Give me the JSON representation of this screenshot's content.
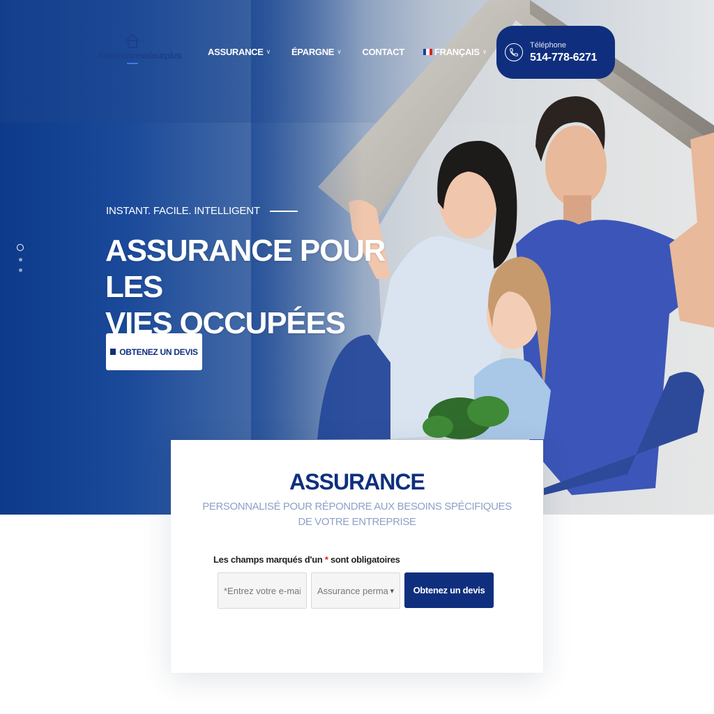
{
  "brand": {
    "logo_text": "Assurancevaleurplus"
  },
  "nav": {
    "items": [
      {
        "label": "ASSURANCE",
        "has_dropdown": true
      },
      {
        "label": "ÉPARGNE",
        "has_dropdown": true
      },
      {
        "label": "CONTACT",
        "has_dropdown": false
      },
      {
        "label": "FRANÇAIS",
        "has_dropdown": true,
        "icon": "france-flag-icon"
      }
    ],
    "chevron": "∨"
  },
  "phone": {
    "label": "Téléphone",
    "number": "514-778-6271",
    "icon": "phone-icon"
  },
  "hero": {
    "tagline": "INSTANT. FACILE. INTELLIGENT",
    "title_line1": "ASSURANCE POUR LES",
    "title_line2": "VIES OCCUPÉES",
    "cta_label": "OBTENEZ UN DEVIS",
    "slides": 3,
    "active_slide": 1
  },
  "form": {
    "title": "ASSURANCE",
    "subtitle": "PERSONNALISÉ POUR RÉPONDRE AUX BESOINS SPÉCIFIQUES DE VOTRE ENTREPRISE",
    "required_note_before": "Les champs marqués d'un",
    "required_star": "*",
    "required_note_after": "sont obligatoires",
    "email_placeholder": "*Entrez votre e-mail",
    "select_value": "Assurance permanente",
    "submit_label": "Obtenez un devis"
  },
  "colors": {
    "primary": "#0f2f7e",
    "subtitle": "#8fa0c7",
    "required": "#e02020"
  }
}
